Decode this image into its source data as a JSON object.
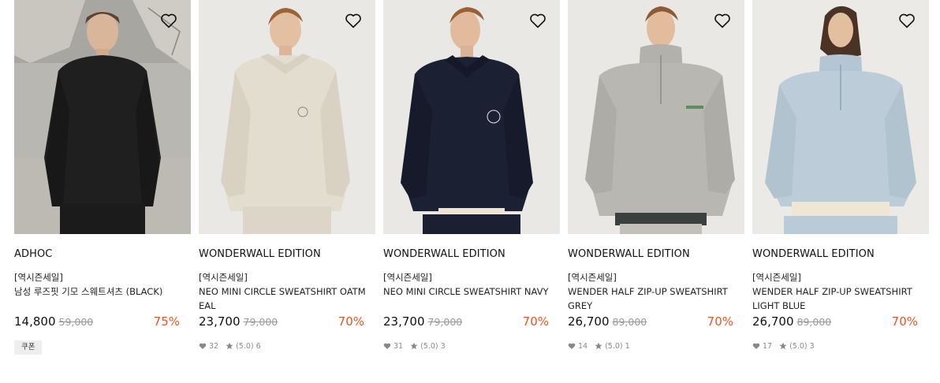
{
  "colors": {
    "accent": "#f0521d",
    "muted": "#999999"
  },
  "products": [
    {
      "brand": "ADHOC",
      "tag": "[역시즌세일]",
      "name": "남성 루즈핏 기모 스웨트셔츠 (BLACK)",
      "price": "14,800",
      "original_price": "59,000",
      "discount": "75%",
      "coupon": "쿠폰",
      "likes": "",
      "rating": "",
      "reviews": "",
      "icon": "heart-outline-icon"
    },
    {
      "brand": "WONDERWALL EDITION",
      "tag": "[역시즌세일]",
      "name": "NEO MINI CIRCLE SWEATSHIRT OATMEAL",
      "price": "23,700",
      "original_price": "79,000",
      "discount": "70%",
      "likes": "32",
      "rating": "(5.0)",
      "reviews": "6",
      "icon": "heart-outline-icon"
    },
    {
      "brand": "WONDERWALL EDITION",
      "tag": "[역시즌세일]",
      "name": "NEO MINI CIRCLE SWEATSHIRT NAVY",
      "price": "23,700",
      "original_price": "79,000",
      "discount": "70%",
      "likes": "31",
      "rating": "(5.0)",
      "reviews": "3",
      "icon": "heart-outline-icon"
    },
    {
      "brand": "WONDERWALL EDITION",
      "tag": "[역시즌세일]",
      "name": "WENDER HALF ZIP-UP SWEATSHIRT GREY",
      "price": "26,700",
      "original_price": "89,000",
      "discount": "70%",
      "likes": "14",
      "rating": "(5.0)",
      "reviews": "1",
      "icon": "heart-outline-icon"
    },
    {
      "brand": "WONDERWALL EDITION",
      "tag": "[역시즌세일]",
      "name": "WENDER HALF ZIP-UP SWEATSHIRT LIGHT BLUE",
      "price": "26,700",
      "original_price": "89,000",
      "discount": "70%",
      "likes": "17",
      "rating": "(5.0)",
      "reviews": "3",
      "icon": "heart-outline-icon"
    }
  ]
}
